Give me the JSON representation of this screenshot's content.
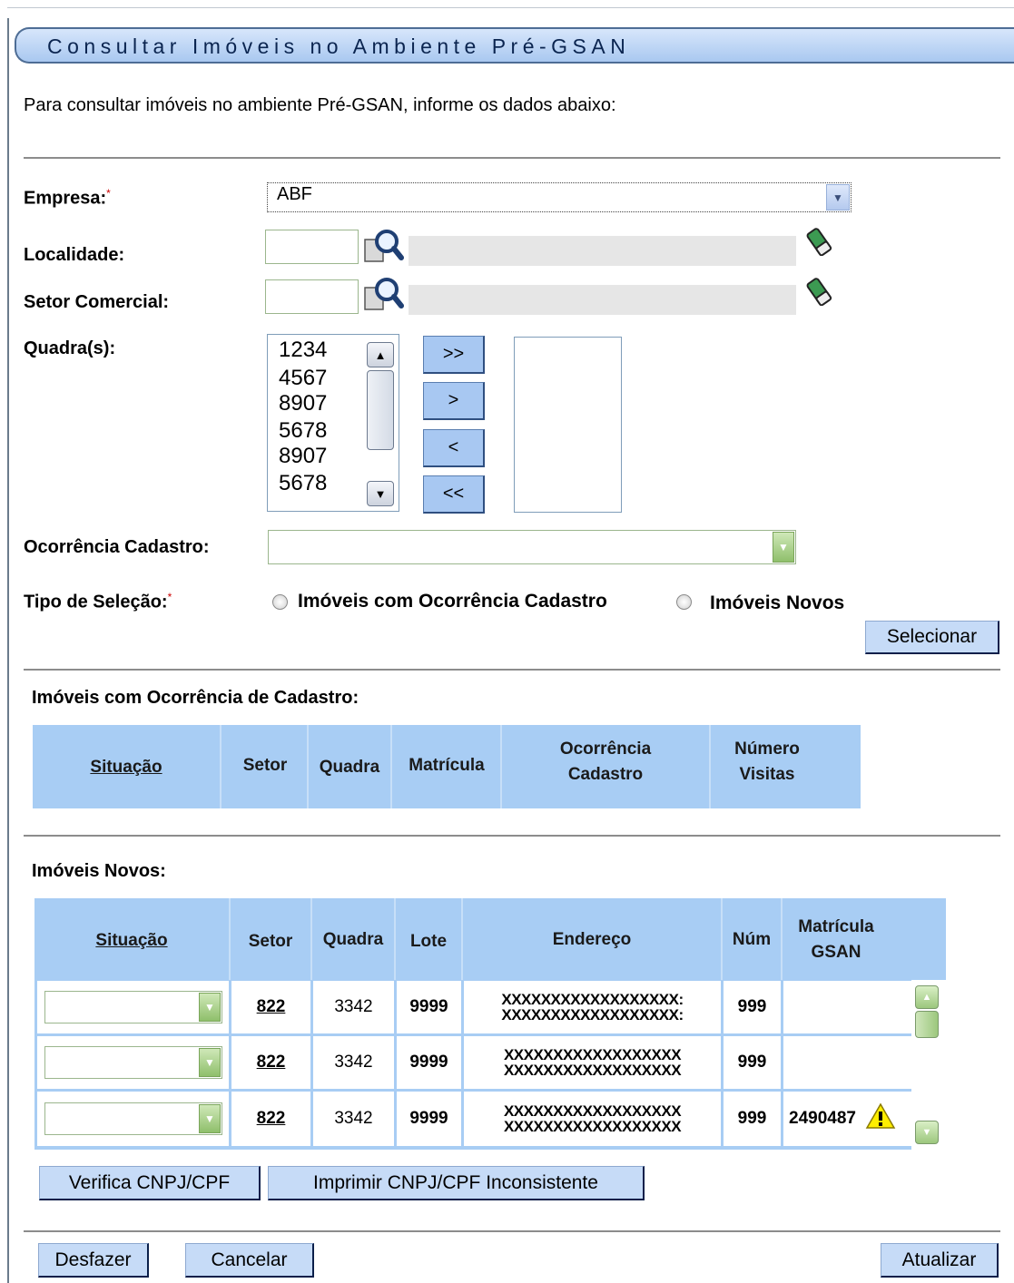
{
  "title": "Consultar Imóveis no Ambiente Pré-GSAN",
  "instructions": "Para consultar imóveis no ambiente Pré-GSAN, informe os dados  abaixo:",
  "form": {
    "empresa_label": "Empresa:",
    "empresa_value": "ABF",
    "localidade_label": "Localidade:",
    "setor_label": "Setor Comercial:",
    "quadras_label": "Quadra(s):",
    "quadras_options": [
      "1234",
      "4567",
      "8907",
      "5678",
      "8907",
      "5678"
    ],
    "move_buttons": [
      ">>",
      ">",
      "<",
      "<<"
    ],
    "ocorrencia_label": "Ocorrência Cadastro:",
    "tipo_label": "Tipo de Seleção:",
    "radio1": "Imóveis com Ocorrência Cadastro",
    "radio2": "Imóveis Novos",
    "selecionar": "Selecionar",
    "required_mark": "*"
  },
  "ocorrencia_section": {
    "title": "Imóveis com Ocorrência de Cadastro:",
    "headers": {
      "situacao": "Situação",
      "setor": "Setor",
      "quadra": "Quadra",
      "matricula": "Matrícula",
      "ocorrencia_l1": "Ocorrência",
      "ocorrencia_l2": "Cadastro",
      "visitas_l1": "Número",
      "visitas_l2": "Visitas"
    }
  },
  "novos_section": {
    "title": "Imóveis  Novos:",
    "headers": {
      "situacao": "Situação",
      "setor": "Setor",
      "quadra": "Quadra",
      "lote": "Lote",
      "endereco": "Endereço",
      "num": "Núm",
      "matricula_l1": "Matrícula",
      "matricula_l2": "GSAN"
    },
    "rows": [
      {
        "setor": "822",
        "quadra": "3342",
        "lote": "9999",
        "addr1": "XXXXXXXXXXXXXXXXXX:",
        "addr2": "XXXXXXXXXXXXXXXXXX:",
        "num": "999",
        "matricula": ""
      },
      {
        "setor": "822",
        "quadra": "3342",
        "lote": "9999",
        "addr1": "XXXXXXXXXXXXXXXXXX",
        "addr2": "XXXXXXXXXXXXXXXXXX",
        "num": "999",
        "matricula": ""
      },
      {
        "setor": "822",
        "quadra": "3342",
        "lote": "9999",
        "addr1": "XXXXXXXXXXXXXXXXXX",
        "addr2": "XXXXXXXXXXXXXXXXXX",
        "num": "999",
        "matricula": "2490487"
      }
    ]
  },
  "buttons": {
    "verifica": "Verifica CNPJ/CPF",
    "imprimir": "Imprimir  CNPJ/CPF  Inconsistente",
    "desfazer": "Desfazer",
    "cancelar": "Cancelar",
    "atualizar": "Atualizar"
  },
  "icons": [
    "search-icon",
    "eraser-icon",
    "chevron-down-icon",
    "chevron-up-icon",
    "warning-icon"
  ],
  "colors": {
    "header_bg": "#a8cdf4",
    "button_bg": "#c6dbf7",
    "title_bg": "#b9d3f5"
  }
}
